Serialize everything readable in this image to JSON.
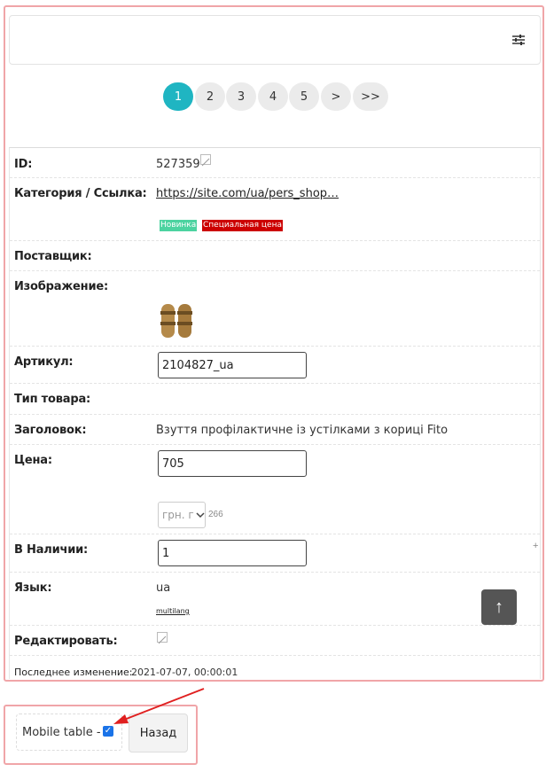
{
  "pagination": {
    "pages": [
      "1",
      "2",
      "3",
      "4",
      "5",
      ">",
      ">>"
    ],
    "active": "1"
  },
  "details": {
    "id_label": "ID:",
    "id_value": "527359",
    "category_label": "Категория / Ссылка:",
    "category_link": "https://site.com/ua/pers_shop…",
    "badge_new": "Новинка",
    "badge_new_color": "#4cd3a0",
    "badge_special": "Специальная цена",
    "badge_special_color": "#cc0000",
    "supplier_label": "Поставщик:",
    "image_label": "Изображение:",
    "sku_label": "Артикул:",
    "sku_value": "2104827_ua",
    "type_label": "Тип товара:",
    "title_label": "Заголовок:",
    "title_value": "Взуття профілактичне із устілками з кориці Fito",
    "price_label": "Цена:",
    "price_value": "705",
    "currency_value": "грн. г",
    "currency_extra": "266",
    "stock_label": "В Наличии:",
    "stock_value": "1",
    "stock_plus": "+",
    "lang_label": "Язык:",
    "lang_value": "ua",
    "lang_multilang": "multilang",
    "edit_label": "Редактировать:",
    "last_modified_label": "Последнее изменение:",
    "last_modified_value": "2021-07-07, 00:00:01"
  },
  "scroll_top_glyph": "↑",
  "footer": {
    "mobile_table_label": "Mobile table -",
    "mobile_table_checked": true,
    "back_button": "Назад"
  },
  "colors": {
    "accent": "#1fb5c2",
    "highlight_frame": "#f0a5a8",
    "annotation_arrow": "#e02020"
  }
}
